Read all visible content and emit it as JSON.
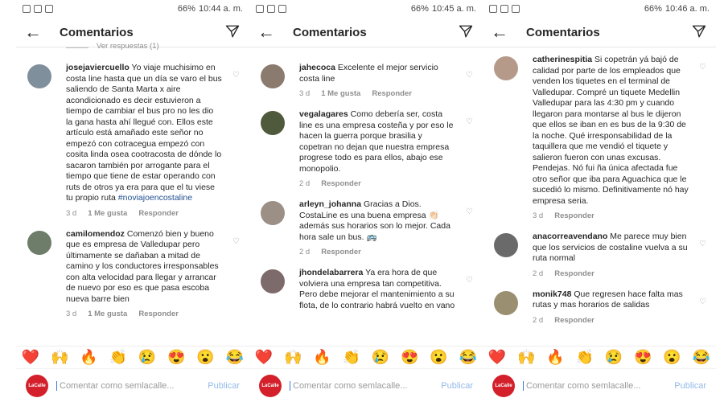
{
  "panels": [
    {
      "status": {
        "battery": "66%",
        "time": "10:44 a. m."
      },
      "header": {
        "title": "Comentarios"
      },
      "view_replies": "Ver respuestas (1)",
      "comments": [
        {
          "user": "josejaviercuello",
          "text": "Yo viaje muchisimo en costa line hasta que un día se varo el bus saliendo de Santa Marta x aire acondicionado es decir estuvieron a tiempo de cambiar el bus pro no les dio la gana hasta ahí llegué con. Ellos este artículo está amañado este señor no empezó con cotracegua empezó con cosita linda osea cootracosta de dónde lo sacaron también por arrogante para el tiempo que tiene de estar operando con ruts de otros ya era para que el tu viese tu propio ruta",
          "tag": "#noviajoencostaline",
          "time": "3 d",
          "likes": "1 Me gusta",
          "reply": "Responder",
          "avatar_color": "#7f8f9c"
        },
        {
          "user": "camilomendoz",
          "text": "Comenzó bien y bueno que es empresa de Valledupar pero últimamente se dañaban a mitad de camino y los conductores irresponsables con alta velocidad para llegar y arrancar de nuevo por eso es que pasa escoba nueva barre bien",
          "tag": "",
          "time": "3 d",
          "likes": "1 Me gusta",
          "reply": "Responder",
          "avatar_color": "#6e7d6a"
        }
      ],
      "input": {
        "placeholder": "Comentar como semlacalle...",
        "publish": "Publicar",
        "logo": "LaCalle"
      }
    },
    {
      "status": {
        "battery": "66%",
        "time": "10:45 a. m."
      },
      "header": {
        "title": "Comentarios"
      },
      "comments": [
        {
          "user": "jahecoca",
          "text": "Excelente el mejor servicio costa line",
          "tag": "",
          "time": "3 d",
          "likes": "1 Me gusta",
          "reply": "Responder",
          "avatar_color": "#8b7a6e"
        },
        {
          "user": "vegalagares",
          "text": "Como debería ser, costa line es una empresa costeña y por eso le hacen la guerra porque brasilia y copetran no dejan que nuestra empresa progrese todo es para ellos, abajo ese monopolio.",
          "tag": "",
          "time": "2 d",
          "likes": "",
          "reply": "Responder",
          "avatar_color": "#4f5a3c"
        },
        {
          "user": "arleyn_johanna",
          "text": "Gracias a Dios. CostaLine es una buena empresa 👏🏻 además sus horarios son lo mejor. Cada hora sale un bus. 🚌",
          "tag": "",
          "time": "2 d",
          "likes": "",
          "reply": "Responder",
          "avatar_color": "#9c8f86"
        },
        {
          "user": "jhondelabarrera",
          "text": "Ya era hora de que volviera una empresa tan competitiva. Pero debe mejorar el mantenimiento a su flota, de lo contrario habrá vuelto en vano",
          "tag": "",
          "time": "",
          "likes": "",
          "reply": "",
          "avatar_color": "#7d6a6a"
        }
      ],
      "input": {
        "placeholder": "Comentar como semlacalle...",
        "publish": "Publicar",
        "logo": "LaCalle"
      }
    },
    {
      "status": {
        "battery": "66%",
        "time": "10:46 a. m."
      },
      "header": {
        "title": "Comentarios"
      },
      "comments": [
        {
          "user": "catherinespitia",
          "text": "Si copetrán yá bajó de calidad por parte de los empleados que venden los tiquetes en el terminal de Valledupar. Compré un tiquete Medellin Valledupar para las 4:30 pm y cuando llegaron para montarse al bus le dijeron que ellos se iban en es bus de la 9:30 de la noche. Qué irresponsabilidad de la taquillera que me vendió el tiquete y salieron fueron con unas excusas. Pendejas. Nó fui ña única afectada fue otro señor que iba para Aguachica que le sucedió lo mismo. Definitivamente nó hay empresa seria.",
          "tag": "",
          "time": "3 d",
          "likes": "",
          "reply": "Responder",
          "avatar_color": "#b59a8a"
        },
        {
          "user": "anacorreavendano",
          "text": "Me parece muy bien que los servicios de costaline vuelva a su ruta normal",
          "tag": "",
          "time": "2 d",
          "likes": "",
          "reply": "Responder",
          "avatar_color": "#6a6a6a"
        },
        {
          "user": "monik748",
          "text": "Que regresen hace falta mas rutas y mas horarios de salidas",
          "tag": "",
          "time": "2 d",
          "likes": "",
          "reply": "Responder",
          "avatar_color": "#9a8f70"
        }
      ],
      "input": {
        "placeholder": "Comentar como semlacalle...",
        "publish": "Publicar",
        "logo": "LaCalle"
      }
    }
  ],
  "emojis": [
    "❤️",
    "🙌",
    "🔥",
    "👏",
    "😢",
    "😍",
    "😮",
    "😂"
  ]
}
